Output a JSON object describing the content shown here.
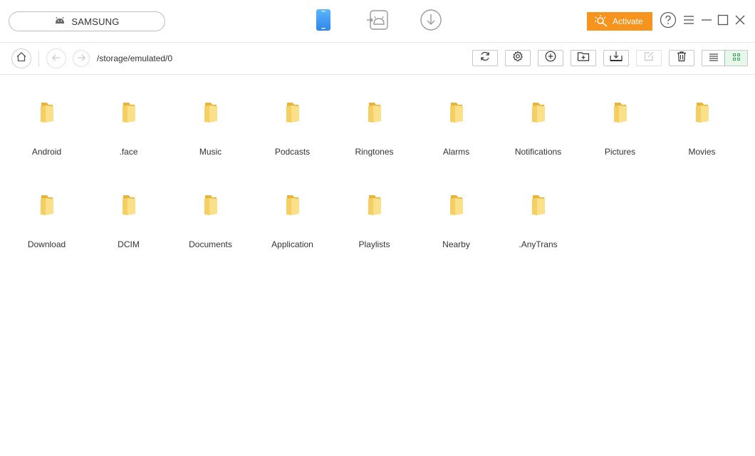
{
  "titlebar": {
    "device_name": "SAMSUNG",
    "activate_label": "Activate",
    "colors": {
      "accent": "#f7941d",
      "phone_tab": "#3a9af0",
      "tab_inactive": "#9a9a9a"
    }
  },
  "toolbar": {
    "path": "/storage/emulated/0",
    "buttons": [
      "refresh",
      "settings",
      "add",
      "new-folder",
      "export",
      "edit",
      "delete"
    ],
    "view_modes": [
      "list",
      "grid"
    ],
    "active_view": "grid"
  },
  "folders": [
    {
      "label": "Android"
    },
    {
      "label": ".face"
    },
    {
      "label": "Music"
    },
    {
      "label": "Podcasts"
    },
    {
      "label": "Ringtones"
    },
    {
      "label": "Alarms"
    },
    {
      "label": "Notifications"
    },
    {
      "label": "Pictures"
    },
    {
      "label": "Movies"
    },
    {
      "label": "Download"
    },
    {
      "label": "DCIM"
    },
    {
      "label": "Documents"
    },
    {
      "label": "Application"
    },
    {
      "label": "Playlists"
    },
    {
      "label": "Nearby"
    },
    {
      "label": ".AnyTrans"
    }
  ]
}
